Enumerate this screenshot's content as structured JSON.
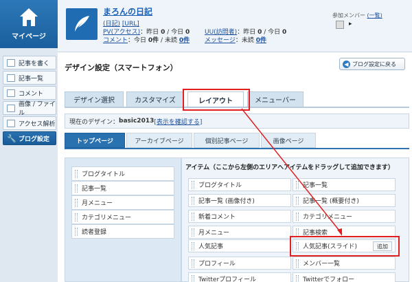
{
  "sidebar": {
    "home_label": "マイページ",
    "items": [
      {
        "label": "記事を書く",
        "icon": "pencil-icon"
      },
      {
        "label": "記事一覧",
        "icon": "list-icon"
      },
      {
        "label": "コメント",
        "icon": "comment-icon"
      },
      {
        "label": "画像 / ファイル",
        "icon": "image-icon"
      },
      {
        "label": "アクセス解析",
        "icon": "chart-icon"
      },
      {
        "label": "ブログ設定",
        "icon": "wrench-icon"
      }
    ]
  },
  "header": {
    "blog_name": "まろんの日記",
    "link_diary": "(日記)",
    "link_url": "[URL]",
    "pv_label": "PV(アクセス)",
    "pv_text": "：昨日",
    "pv_yesterday": "0",
    "pv_today_label": "/ 今日",
    "pv_today": "0",
    "uu_label": "UU(訪問者)",
    "uu_text": "：昨日",
    "uu_yesterday": "0",
    "uu_today_label": "/ 今日",
    "uu_today": "0",
    "comment_label": "コメント",
    "comment_text": "：今日",
    "comment_today": "0件",
    "comment_unread_label": "/ 未読",
    "comment_unread": "0件",
    "message_label": "メッセージ",
    "message_unread_label": "：未読",
    "message_unread": "0件",
    "members_label": "参加メンバー",
    "members_list_link": "(一覧)",
    "members_next": "▸"
  },
  "page": {
    "title": "デザイン設定（スマートフォン）",
    "back_button": "ブログ設定に戻る"
  },
  "main_tabs": [
    "デザイン選択",
    "カスタマイズ",
    "レイアウト",
    "メニューバー"
  ],
  "current_design": {
    "label": "現在のデザイン：",
    "name": "basic2013",
    "link": "[表示を確認する]"
  },
  "sub_tabs": [
    "トップページ",
    "アーカイブページ",
    "個別記事ページ",
    "画像ページ"
  ],
  "left_items": [
    "ブログタイトル",
    "記事一覧",
    "月メニュー",
    "カテゴリメニュー",
    "読者登録"
  ],
  "items_title": "アイテム（ここから左側のエリアへアイテムをドラッグして追加できます）",
  "right_items": [
    [
      "ブログタイトル",
      "記事一覧"
    ],
    [
      "記事一覧 (画像付き)",
      "記事一覧 (概要付き)"
    ],
    [
      "新着コメント",
      "カテゴリメニュー"
    ],
    [
      "月メニュー",
      "記事検索"
    ],
    [
      "人気記事",
      "人気記事(スライド)"
    ],
    [
      "プロフィール",
      "メンバー一覧"
    ],
    [
      "Twitterプロフィール",
      "Twitterでフォロー"
    ]
  ],
  "add_label": "追加",
  "colors": {
    "accent": "#2a71b0",
    "highlight": "#e02020"
  }
}
